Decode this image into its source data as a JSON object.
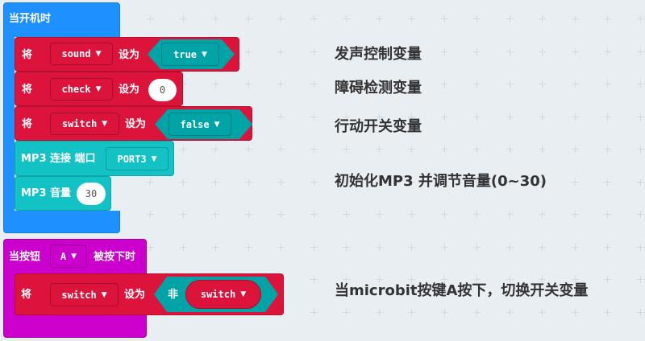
{
  "on_start": {
    "label": "当开机时"
  },
  "set_label": "将",
  "to_label": "设为",
  "blocks": [
    {
      "variable": "sound",
      "value": "true"
    },
    {
      "variable": "check",
      "value": "0"
    },
    {
      "variable": "switch",
      "value": "false"
    }
  ],
  "mp3_connect": {
    "label": "MP3 连接 端口",
    "port": "PORT3"
  },
  "mp3_volume": {
    "label": "MP3 音量",
    "value": "30"
  },
  "on_button": {
    "prefix": "当按钮",
    "button": "A",
    "suffix": "被按下时"
  },
  "toggle": {
    "variable": "switch",
    "not_label": "非",
    "operand": "switch"
  },
  "comments": [
    "发声控制变量",
    "障碍检测变量",
    "行动开关变量",
    "初始化MP3 并调节音量(0~30)",
    "当microbit按键A按下，切换开关变量"
  ],
  "colors": {
    "basic": "#1e90ff",
    "variables": "#dc143c",
    "mp3": "#12c2c4",
    "input": "#cc00cc",
    "logic": "#00a4a6"
  }
}
